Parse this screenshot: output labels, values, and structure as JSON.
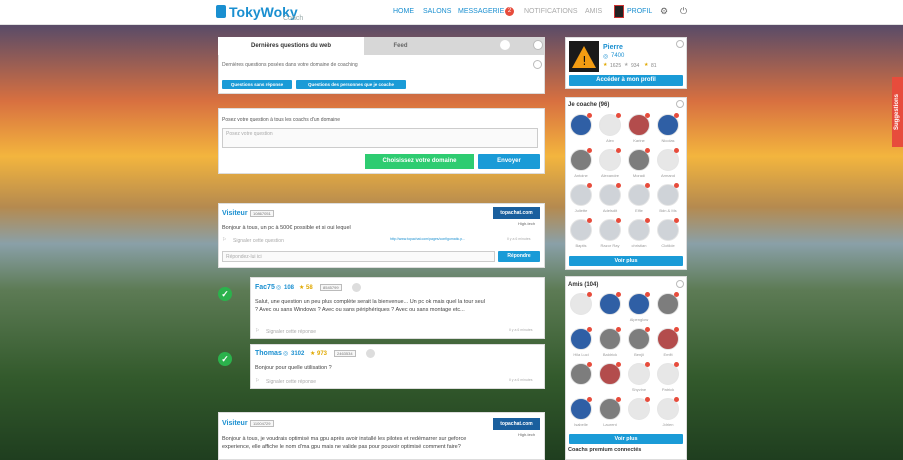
{
  "header": {
    "logo_text": "TokyWoky",
    "logo_sub": "Coach",
    "nav": {
      "home": "HOME",
      "salons": "SALONS",
      "messagerie": "MESSAGERIE",
      "messagerie_count": "2",
      "notifications": "NOTIFICATIONS",
      "amis": "AMIS",
      "profil": "PROFIL"
    }
  },
  "tabs": {
    "questions": "Dernières questions du web",
    "feed": "Feed"
  },
  "questions_panel": {
    "subtitle": "Dernières questions posées dans votre domaine de coaching",
    "btn_unanswered": "Questions sans réponse",
    "btn_my_people": "Questions des personnes que je coache"
  },
  "ask": {
    "label": "Posez votre question à tous les coachs d'un domaine",
    "placeholder": "Posez votre question",
    "choose_domain": "Choisissez votre domaine",
    "send": "Envoyer"
  },
  "post1": {
    "user": "Visiteur",
    "id": "10867051",
    "partner": "topachat.com",
    "category": "High-tech",
    "text": "Bonjour à tous, un pc à 500€ possible et si oui lequel",
    "report": "Signaler cette question",
    "link": "http://www.topachat.com/pages/configomatic.p...",
    "time": "Il y a 6 minutes",
    "reply_placeholder": "Répondez-lui ici",
    "reply_btn": "Répondre"
  },
  "answer1": {
    "user": "Fac75",
    "points": "108",
    "stars": "58",
    "id": "8545799",
    "text": "Salut, une question un peu plus complète serait la bienvenue... Un pc ok mais quel la tour seul ? Avec ou sans Windows ? Avec ou sans périphériques ? Avec ou sans montage etc...",
    "report": "Signaler cette réponse",
    "time": "Il y a 6 minutes"
  },
  "answer2": {
    "user": "Thomas",
    "points": "3102",
    "stars": "973",
    "id": "2463534",
    "text": "Bonjour pour quelle utilisation ?",
    "report": "Signaler cette réponse",
    "time": "Il y a 6 minutes"
  },
  "post2": {
    "user": "Visiteur",
    "id": "11004729",
    "partner": "topachat.com",
    "category": "High-tech",
    "text": "Bonjour à tous, je voudrais optimisé ma gpu après avoir installé les pilotes et redémarrer sur geforce experience, elle affiche le nom d'ma gpu mais ne valide pas pour pouvoir optimisé comment faire?"
  },
  "profile": {
    "name": "Pierre",
    "points": "7400",
    "stat1": "1625",
    "stat2": "934",
    "stat3": "81",
    "access_btn": "Accéder à mon profil"
  },
  "coach": {
    "title": "Je coache (96)",
    "names": [
      "",
      "Alex",
      "Karine",
      "Nicolas",
      "Antoine",
      "Alexandre",
      "Moradi",
      "Armand",
      "Juliette",
      "Adelsdit",
      "Elfie",
      "Bdn & Ms",
      "Baptis",
      "Razor Ray",
      "christian",
      "Clotilde"
    ],
    "more": "Voir plus"
  },
  "friends": {
    "title": "Amis (104)",
    "names": [
      "",
      "",
      "Alpenglow",
      "",
      "Hila Luci",
      "Baldrick",
      "Benjii",
      "Emfit",
      "",
      "",
      "Shyvine",
      "Patrick",
      "Isabelle",
      "Laurent",
      "",
      "Jdrien"
    ],
    "more": "Voir plus"
  },
  "premium": {
    "title": "Coachs premium connectés"
  },
  "suggestions": "Suggestions"
}
